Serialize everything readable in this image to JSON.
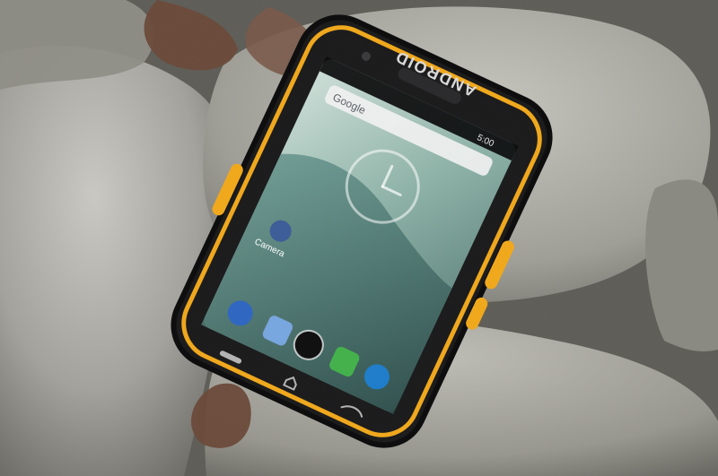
{
  "photo": {
    "brand_text": "ANDROID",
    "status_time": "5:00",
    "search_brand": "Google",
    "app_label": "Camera"
  },
  "colors": {
    "rock_light": "#b9b8b1",
    "rock_mid": "#8f8e87",
    "rock_dark": "#5e5d57",
    "leaf_brown": "#6b4a3a",
    "phone_body": "#1b1b1c",
    "phone_accent": "#f0a81c",
    "screen_sky": "#8fb3a8",
    "screen_water": "#5f8a84"
  }
}
